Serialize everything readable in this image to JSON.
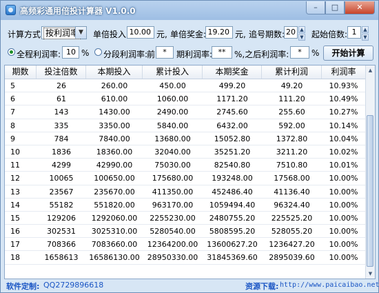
{
  "window": {
    "title": "高频彩通用倍投计算器 V1.0.0",
    "minimize_glyph": "–",
    "maximize_glyph": "□",
    "close_glyph": "✕"
  },
  "controls": {
    "calc_mode_label": "计算方式:",
    "calc_mode_value": "按利润率",
    "unit_bet_label": "单倍投入:",
    "unit_bet_value": "10.00",
    "unit_bet_unit": "元,",
    "unit_prize_label": "单倍奖金:",
    "unit_prize_value": "19.20",
    "unit_prize_unit": "元,",
    "periods_label": "追号期数:",
    "periods_value": "20",
    "start_mult_label": "起始倍数:",
    "start_mult_value": "1",
    "full_profit_label": "全程利润率:",
    "full_profit_value": "10",
    "percent": "%",
    "segment_label": "分段利润率:",
    "segment_front_label": "前",
    "segment_front_value": "*",
    "segment_rate_label": "期利润率:",
    "segment_rate_value": "**",
    "after_label": "%,之后利润率:",
    "after_value": "*",
    "start_button": "开始计算",
    "full_profit_selected": true
  },
  "table": {
    "headers": [
      "期数",
      "投注倍数",
      "本期投入",
      "累计投入",
      "本期奖金",
      "累计利润",
      "利润率"
    ],
    "rows": [
      [
        "5",
        "26",
        "260.00",
        "450.00",
        "499.20",
        "49.20",
        "10.93%"
      ],
      [
        "6",
        "61",
        "610.00",
        "1060.00",
        "1171.20",
        "111.20",
        "10.49%"
      ],
      [
        "7",
        "143",
        "1430.00",
        "2490.00",
        "2745.60",
        "255.60",
        "10.27%"
      ],
      [
        "8",
        "335",
        "3350.00",
        "5840.00",
        "6432.00",
        "592.00",
        "10.14%"
      ],
      [
        "9",
        "784",
        "7840.00",
        "13680.00",
        "15052.80",
        "1372.80",
        "10.04%"
      ],
      [
        "10",
        "1836",
        "18360.00",
        "32040.00",
        "35251.20",
        "3211.20",
        "10.02%"
      ],
      [
        "11",
        "4299",
        "42990.00",
        "75030.00",
        "82540.80",
        "7510.80",
        "10.01%"
      ],
      [
        "12",
        "10065",
        "100650.00",
        "175680.00",
        "193248.00",
        "17568.00",
        "10.00%"
      ],
      [
        "13",
        "23567",
        "235670.00",
        "411350.00",
        "452486.40",
        "41136.40",
        "10.00%"
      ],
      [
        "14",
        "55182",
        "551820.00",
        "963170.00",
        "1059494.40",
        "96324.40",
        "10.00%"
      ],
      [
        "15",
        "129206",
        "1292060.00",
        "2255230.00",
        "2480755.20",
        "225525.20",
        "10.00%"
      ],
      [
        "16",
        "302531",
        "3025310.00",
        "5280540.00",
        "5808595.20",
        "528055.20",
        "10.00%"
      ],
      [
        "17",
        "708366",
        "7083660.00",
        "12364200.00",
        "13600627.20",
        "1236427.20",
        "10.00%"
      ],
      [
        "18",
        "1658613",
        "16586130.00",
        "28950330.00",
        "31845369.60",
        "2895039.60",
        "10.00%"
      ]
    ],
    "scroll_up_glyph": "▲",
    "scroll_down_glyph": "▼"
  },
  "status": {
    "custom_label": "软件定制:",
    "custom_qq": "QQ2729896618",
    "download_label": "资源下载:",
    "download_url": "http://www.paicaibao.net"
  },
  "icons": {
    "app": "app-icon",
    "dropdown": "chevron-down-icon",
    "spin": "spin-arrows-icon"
  }
}
